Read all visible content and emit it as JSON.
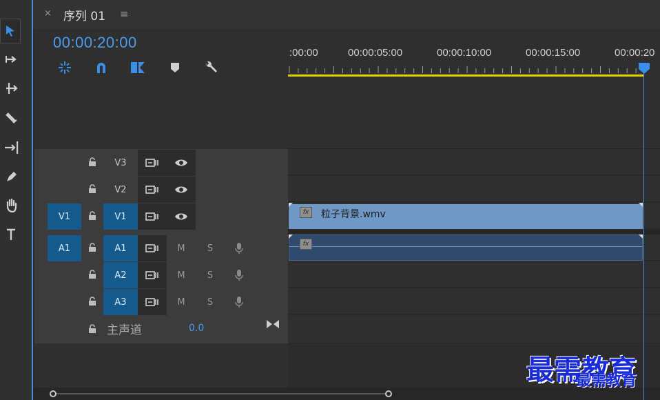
{
  "header": {
    "close": "×",
    "title": "序列 01",
    "menu": "≡"
  },
  "timecode": "00:00:20:00",
  "ruler": {
    "labels": [
      ":00:00",
      "00:00:05:00",
      "00:00:10:00",
      "00:00:15:00",
      "00:00:20"
    ]
  },
  "tracks": {
    "video": [
      {
        "name": "V3",
        "source": ""
      },
      {
        "name": "V2",
        "source": ""
      },
      {
        "name": "V1",
        "source": "V1"
      }
    ],
    "audio": [
      {
        "name": "A1",
        "source": "A1",
        "m": "M",
        "s": "S"
      },
      {
        "name": "A2",
        "source": "",
        "m": "M",
        "s": "S"
      },
      {
        "name": "A3",
        "source": "",
        "m": "M",
        "s": "S"
      }
    ],
    "master": {
      "label": "主声道",
      "value": "0.0"
    }
  },
  "clips": {
    "video_label": "粒子背景.wmv",
    "fx": "fx"
  },
  "watermark": "最需教育",
  "colors": {
    "accent": "#4a9cf0",
    "selected_track": "#145a8c",
    "video_clip": "#7098c7",
    "audio_clip": "#2f4a6d",
    "work_area": "#e3d400"
  }
}
